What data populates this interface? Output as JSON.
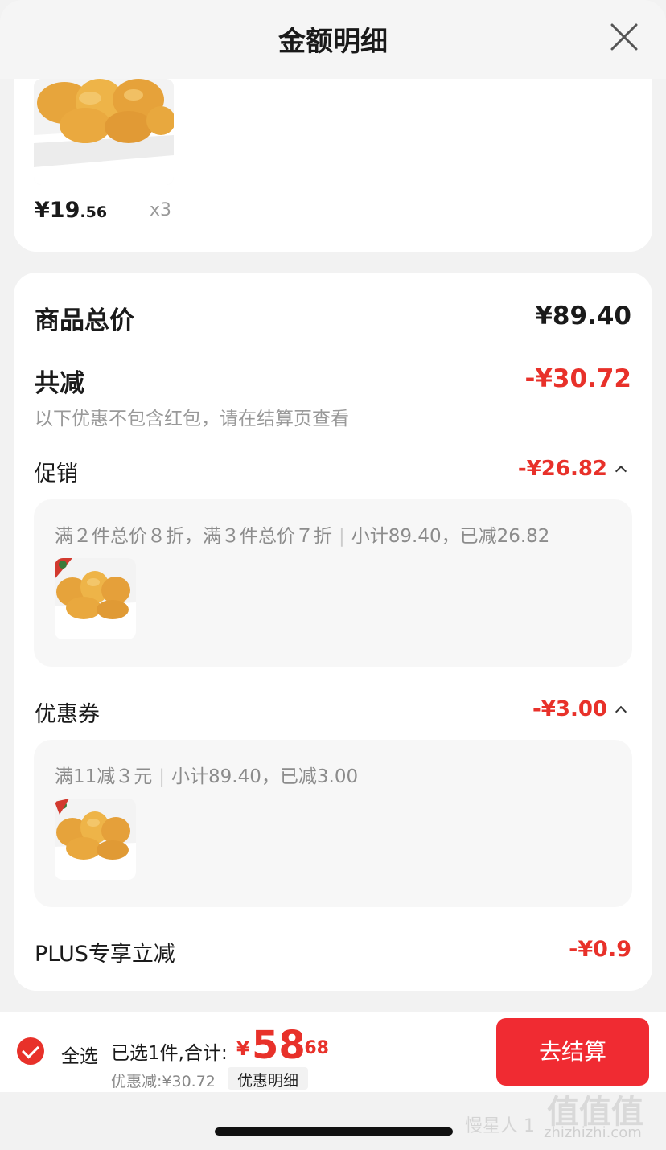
{
  "header": {
    "title": "金额明细"
  },
  "product": {
    "price_symbol": "¥",
    "price_int": "19",
    "price_dec": ".56",
    "qty": "x3"
  },
  "summary": {
    "total_label": "商品总价",
    "total_value": "¥89.40",
    "reduce_label": "共减",
    "reduce_value": "-¥30.72",
    "reduce_note": "以下优惠不包含红包，请在结算页查看",
    "promo": {
      "label": "促销",
      "value": "-¥26.82",
      "rule": "满２件总价８折，满３件总价７折",
      "subtotal": "小计89.40，已减26.82"
    },
    "coupon": {
      "label": "优惠券",
      "value": "-¥3.00",
      "rule": "满11减３元",
      "subtotal": "小计89.40，已减3.00"
    },
    "plus": {
      "label": "PLUS专享立减",
      "value": "-¥0.9"
    }
  },
  "bottom": {
    "select_all": "全选",
    "selected_info": "已选1件,合计:",
    "total_symbol": "¥",
    "total_int": "58",
    "total_dec": ".68",
    "discount_info": "优惠减:¥30.72",
    "detail_link": "优惠明细",
    "checkout": "去结算"
  },
  "watermark": {
    "text": "慢星人 1",
    "logo": "值值值",
    "site": "zhizhizhi.com"
  },
  "colors": {
    "accent": "#e8312a",
    "button": "#f02b32"
  }
}
